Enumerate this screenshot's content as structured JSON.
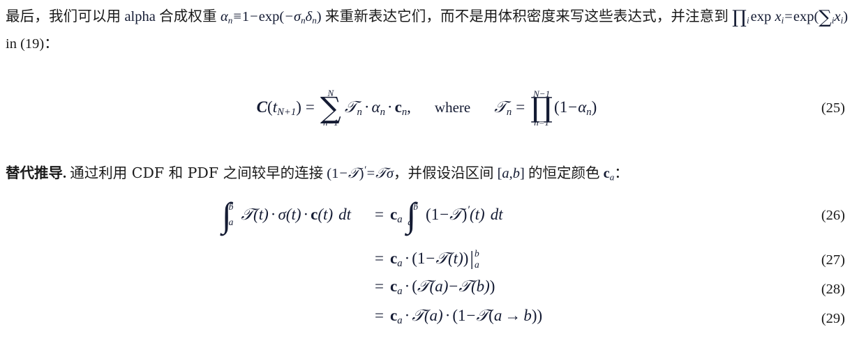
{
  "document": {
    "language": "zh-CN",
    "background_color": "#ffffff",
    "text_color": "#1a1a1a",
    "math_color": "#141b33"
  },
  "paragraph_1": {
    "line1_part1": "最后，我们可以用",
    "line1_math_alpha_label": "alpha",
    "line1_part2": "合成权重",
    "line1_formula_alpha": "α",
    "line1_formula_alpha_sub": "n",
    "line1_formula_equiv": "≡",
    "line1_formula_one": "1",
    "line1_formula_minus": "−",
    "line1_formula_exp": "exp",
    "line1_formula_paren_open": "(",
    "line1_formula_neg_sigma": "−σ",
    "line1_formula_sigma_sub": "n",
    "line1_formula_delta": "δ",
    "line1_formula_delta_sub": "n",
    "line1_formula_paren_close": ")",
    "line1_part3": "来重新表达它们，而不是用体积密度来写这",
    "line2_part1": "些表达式，并注意到",
    "line2_prod": "∏",
    "line2_prod_sub": "i",
    "line2_exp": "exp",
    "line2_x": "x",
    "line2_x_sub": "i",
    "line2_eq": "=",
    "line2_exp2": "exp",
    "line2_sum": "∑",
    "line2_sum_sub": "i",
    "line2_x2": "x",
    "line2_x2_sub": "i",
    "line2_tail": "in (19)："
  },
  "equation_25": {
    "number": "(25)",
    "lhs_C": "C",
    "lhs_paren_open": "(",
    "lhs_t": "t",
    "lhs_t_sub": "N+1",
    "lhs_paren_close": ")",
    "eq": "=",
    "sum_sym": "∑",
    "sum_upper": "N",
    "sum_lower": "n=1",
    "term_T": "𝒯",
    "term_T_sub": "n",
    "dot1": "·",
    "term_alpha": "α",
    "term_alpha_sub": "n",
    "dot2": "·",
    "term_c": "c",
    "term_c_sub": "n",
    "comma": ",",
    "where": "where",
    "rhs_T": "𝒯",
    "rhs_T_sub": "n",
    "rhs_eq": "=",
    "prod_sym": "∏",
    "prod_upper": "N−1",
    "prod_lower": "n=1",
    "rhs_paren_open": "(",
    "rhs_one": "1",
    "rhs_minus": "−",
    "rhs_alpha": "α",
    "rhs_alpha_sub": "n",
    "rhs_paren_close": ")"
  },
  "paragraph_2": {
    "heading": "替代推导",
    "heading_period": ".",
    "body_part1": "通过利用 CDF 和 PDF 之间较早的连接",
    "formula_paren_open": "(",
    "formula_one": "1",
    "formula_minus": "−",
    "formula_T": "𝒯",
    "formula_paren_close": ")",
    "formula_prime": "′",
    "formula_eq": "=",
    "formula_T2": "𝒯",
    "formula_sigma": "σ",
    "body_part2": "，并假设沿区间",
    "interval_open": "[",
    "interval_a": "a",
    "interval_comma": ",",
    "interval_b": "b",
    "interval_close": "]",
    "body_part3": "的恒定颜色",
    "color_c": "c",
    "color_c_sub": "a",
    "body_colon": "："
  },
  "equation_26": {
    "number": "(26)",
    "int_sym": "∫",
    "int_upper": "b",
    "int_lower": "a",
    "T": "𝒯",
    "t1": "(t)",
    "dot1": "·",
    "sigma": "σ",
    "t2": "(t)",
    "dot2": "·",
    "c": "c",
    "t3": "(t)",
    "dt": "dt",
    "eq": "=",
    "ca": "c",
    "ca_sub": "a",
    "int2_sym": "∫",
    "int2_upper": "b",
    "int2_lower": "a",
    "paren_open": "(",
    "one": "1",
    "minus": "−",
    "T2": "𝒯",
    "paren_close": ")",
    "prime": "′",
    "t4": "(t)",
    "dt2": "dt"
  },
  "equation_27": {
    "number": "(27)",
    "eq": "=",
    "ca": "c",
    "ca_sub": "a",
    "dot": "·",
    "paren_open": "(",
    "one": "1",
    "minus": "−",
    "T": "𝒯",
    "t": "(t)",
    "paren_close": ")",
    "eval_bar": "|",
    "eval_upper": "b",
    "eval_lower": "a"
  },
  "equation_28": {
    "number": "(28)",
    "eq": "=",
    "ca": "c",
    "ca_sub": "a",
    "dot": "·",
    "paren_open": "(",
    "T1": "𝒯",
    "a": "(a)",
    "minus": "−",
    "T2": "𝒯",
    "b": "(b)",
    "paren_close": ")"
  },
  "equation_29": {
    "number": "(29)",
    "eq": "=",
    "ca": "c",
    "ca_sub": "a",
    "dot1": "·",
    "T1": "𝒯",
    "a1": "(a)",
    "dot2": "·",
    "paren_open": "(",
    "one": "1",
    "minus": "−",
    "T2": "𝒯",
    "arrow_open": "(",
    "arrow_a": "a",
    "arrow": "→",
    "arrow_b": "b",
    "arrow_close": ")",
    "paren_close": ")"
  }
}
